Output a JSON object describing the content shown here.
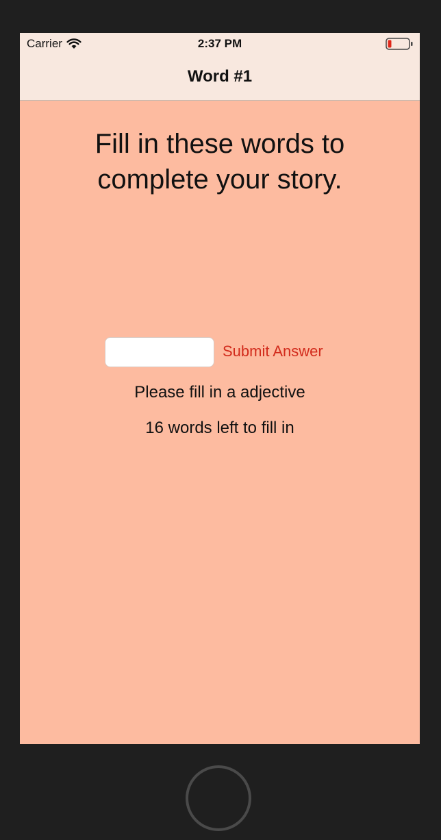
{
  "status_bar": {
    "carrier": "Carrier",
    "time": "2:37 PM",
    "icons": [
      "wifi-icon",
      "battery-low-icon"
    ]
  },
  "nav": {
    "title": "Word #1"
  },
  "main": {
    "instruction": "Fill in these words to complete your story.",
    "answer_input": {
      "value": "",
      "placeholder": ""
    },
    "submit_label": "Submit Answer",
    "prompt": "Please fill in a adjective",
    "remaining": "16 words left to fill in"
  },
  "colors": {
    "background": "#fdbba0",
    "nav_bar": "#f8e8df",
    "accent": "#d22b1c",
    "device_frame": "#1f1f1f",
    "battery_low": "#e0271a"
  },
  "device": {
    "home_button": "home-button"
  }
}
